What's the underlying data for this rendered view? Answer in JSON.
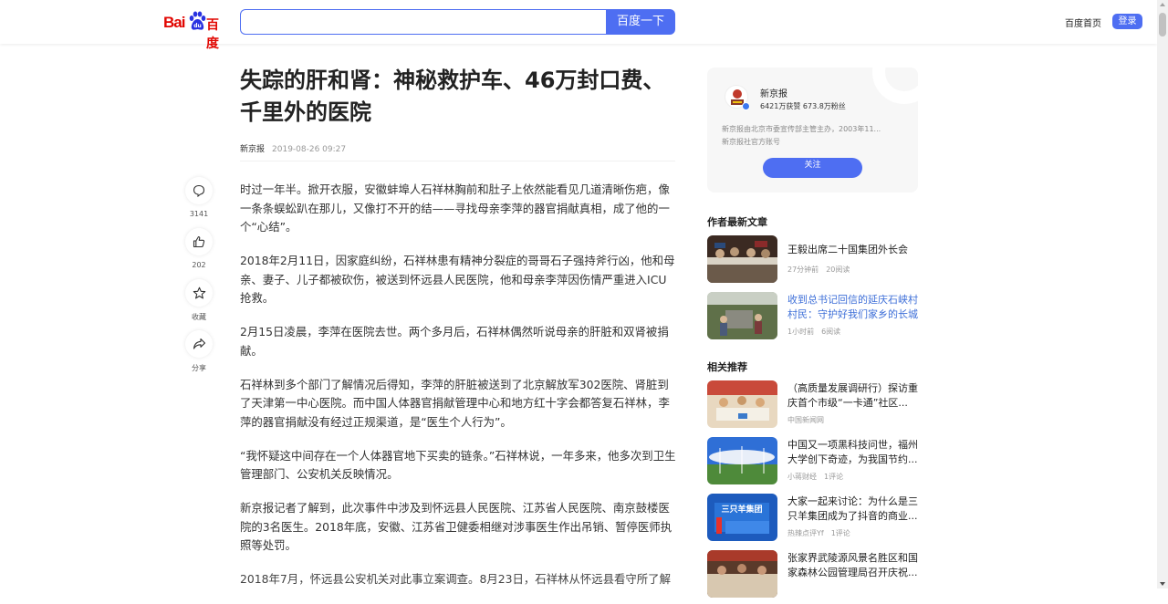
{
  "header": {
    "logo_text_bai": "Bai",
    "logo_text_du": "百度",
    "search_placeholder": "",
    "search_button": "百度一下",
    "home_link": "百度首页",
    "login_button": "登录"
  },
  "article": {
    "title": "失踪的肝和肾：神秘救护车、46万封口费、千里外的医院",
    "source": "新京报",
    "date": "2019-08-26 09:27",
    "paragraphs": [
      "时过一年半。掀开衣服，安徽蚌埠人石祥林胸前和肚子上依然能看见几道清晰伤疤，像一条条蜈蚣趴在那儿，又像打不开的结——寻找母亲李萍的器官捐献真相，成了他的一个“心结”。",
      "2018年2月11日，因家庭纠纷，石祥林患有精神分裂症的哥哥石子强持斧行凶，他和母亲、妻子、儿子都被砍伤，被送到怀远县人民医院，他和母亲李萍因伤情严重进入ICU抢救。",
      "2月15日凌晨，李萍在医院去世。两个多月后，石祥林偶然听说母亲的肝脏和双肾被捐献。",
      "石祥林到多个部门了解情况后得知，李萍的肝脏被送到了北京解放军302医院、肾脏到了天津第一中心医院。而中国人体器官捐献管理中心和地方红十字会都答复石祥林，李萍的器官捐献没有经过正规渠道，是“医生个人行为”。",
      "“我怀疑这中间存在一个人体器官地下买卖的链条。”石祥林说，一年多来，他多次到卫生管理部门、公安机关反映情况。",
      "新京报记者了解到，此次事件中涉及到怀远县人民医院、江苏省人民医院、南京鼓楼医院的3名医生。2018年底，安徽、江苏省卫健委相继对涉事医生作出吊销、暂停医师执照等处罚。",
      "2018年7月，怀远县公安机关对此事立案调查。8月23日，石祥林从怀远县看守所了解"
    ]
  },
  "actions": {
    "comment_count": "3141",
    "like_count": "202",
    "favorite_label": "收藏",
    "share_label": "分享"
  },
  "author": {
    "name": "新京报",
    "stats": "6421万获赞 673.8万粉丝",
    "desc_line1": "新京报由北京市委宣传部主管主办，2003年11...",
    "desc_line2": "新京报社官方账号",
    "follow_label": "关注"
  },
  "latest": {
    "title": "作者最新文章",
    "items": [
      {
        "title": "王毅出席二十国集团外长会",
        "time": "27分钟前",
        "reads": "20阅读"
      },
      {
        "title": "收到总书记回信的延庆石峡村村民：守护好我们家乡的长城",
        "time": "1小时前",
        "reads": "6阅读"
      }
    ]
  },
  "related": {
    "title": "相关推荐",
    "items": [
      {
        "title": "（高质量发展调研行）探访重庆首个市级“一卡通”社区...",
        "source": "中国新闻网",
        "extra": ""
      },
      {
        "title": "中国又一项黑科技问世，福州大学创下奇迹，为我国节约...",
        "source": "小蒋财经",
        "extra": "1评论"
      },
      {
        "title": "大家一起来讨论：为什么是三只羊集团成为了抖音的商业...",
        "source": "热辣点评Yf",
        "extra": "1评论"
      },
      {
        "title": "张家界武陵源风景名胜区和国家森林公园管理局召开庆祝...",
        "source": "",
        "extra": ""
      }
    ]
  },
  "colors": {
    "brand_blue": "#4e6ef2",
    "baidu_red": "#e10601",
    "link_blue": "#3e6fd8"
  }
}
